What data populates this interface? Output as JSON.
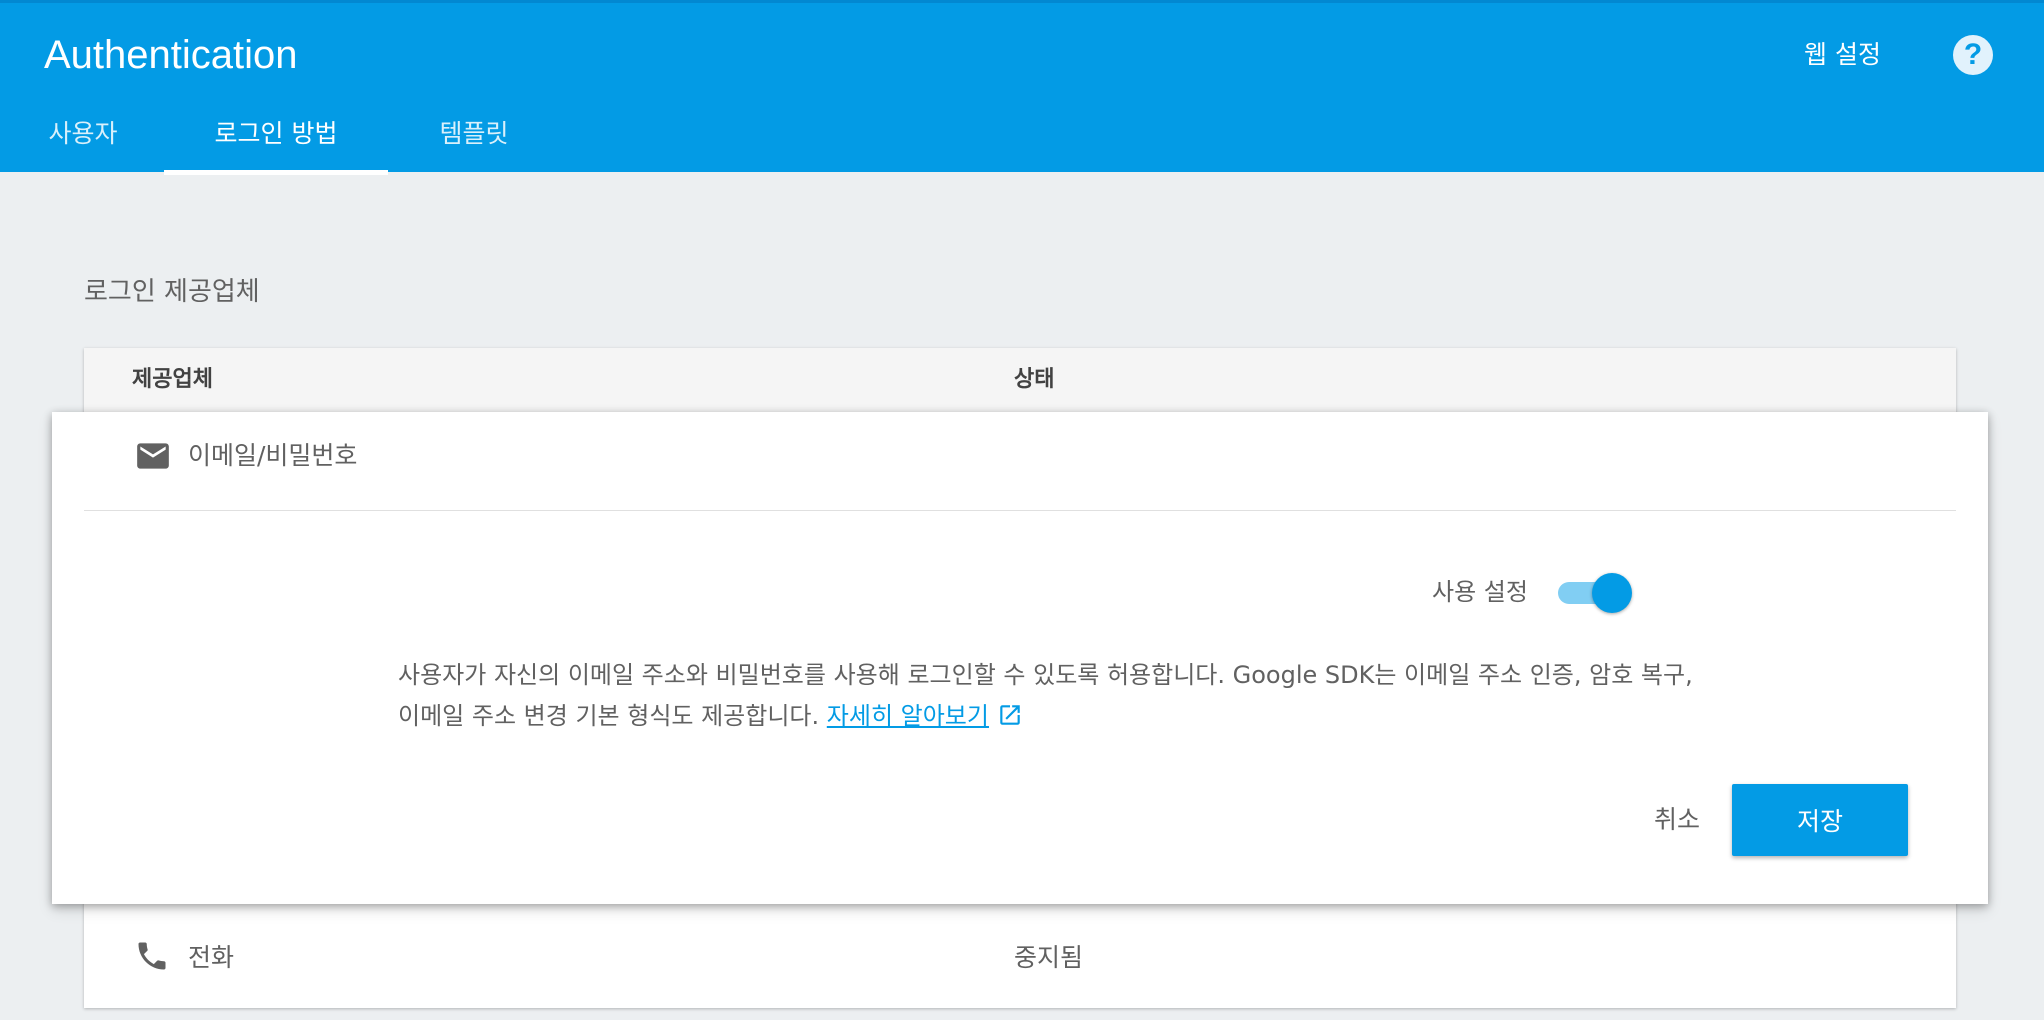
{
  "app": {
    "title": "Authentication",
    "web_setup": "웹 설정",
    "help": "?"
  },
  "tabs": [
    {
      "label": "사용자",
      "active": false
    },
    {
      "label": "로그인 방법",
      "active": true
    },
    {
      "label": "템플릿",
      "active": false
    }
  ],
  "section": {
    "title": "로그인 제공업체"
  },
  "table": {
    "columns": [
      "제공업체",
      "상태"
    ],
    "expanded": {
      "icon": "email-icon",
      "name": "이메일/비밀번호",
      "enable_label": "사용 설정",
      "enabled": true,
      "description": "사용자가 자신의 이메일 주소와 비밀번호를 사용해 로그인할 수 있도록 허용합니다. Google SDK는 이메일 주소 인증, 암호 복구, 이메일 주소 변경 기본 형식도 제공합니다.",
      "learn_more": "자세히 알아보기",
      "cancel": "취소",
      "save": "저장"
    },
    "rows": [
      {
        "icon": "phone-icon",
        "name": "전화",
        "status": "중지됨"
      }
    ]
  },
  "colors": {
    "primary": "#039be5",
    "toggle_track": "#81cef3",
    "background": "#eceff1"
  }
}
